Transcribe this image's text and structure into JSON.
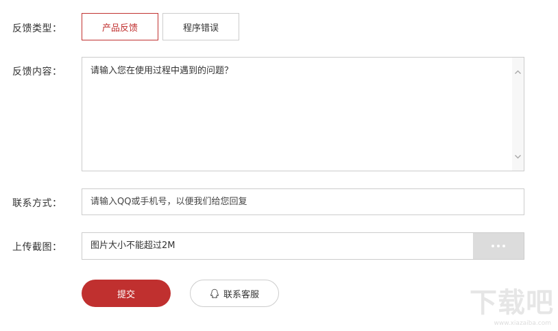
{
  "form": {
    "type_label": "反馈类型：",
    "type_options": [
      "产品反馈",
      "程序错误"
    ],
    "content_label": "反馈内容：",
    "content_placeholder": "请输入您在使用过程中遇到的问题？",
    "contact_label": "联系方式：",
    "contact_placeholder": "请输入QQ或手机号，以便我们给您回复",
    "upload_label": "上传截图：",
    "upload_placeholder": "图片大小不能超过2M"
  },
  "actions": {
    "submit_label": "提交",
    "service_label": "联系客服"
  },
  "watermark": {
    "text": "下载吧",
    "url": "www.xiazaiba.com"
  },
  "colors": {
    "accent": "#c0302f",
    "border": "#cccccc",
    "browse_bg": "#dcdcdc"
  },
  "icons": {
    "browse": "ellipsis-icon",
    "service": "qq-icon"
  }
}
